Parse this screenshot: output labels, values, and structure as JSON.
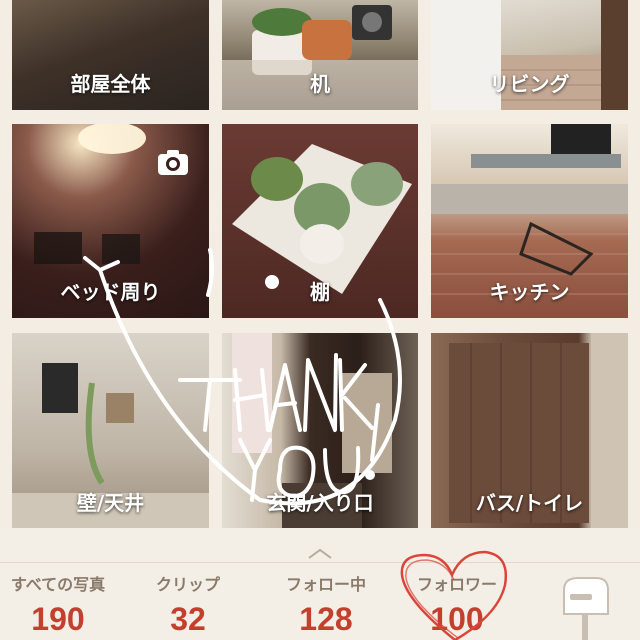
{
  "categories": [
    {
      "label": "部屋全体"
    },
    {
      "label": "机"
    },
    {
      "label": "リビング"
    },
    {
      "label": "ベッド周り"
    },
    {
      "label": "棚"
    },
    {
      "label": "キッチン"
    },
    {
      "label": "壁/天井"
    },
    {
      "label": "玄関/入り口"
    },
    {
      "label": "バス/トイレ"
    }
  ],
  "icons": {
    "camera": "camera-icon",
    "expand": "chevron-up-icon",
    "mailbox": "mailbox-icon"
  },
  "stats": [
    {
      "label": "すべての写真",
      "value": "190"
    },
    {
      "label": "クリップ",
      "value": "32"
    },
    {
      "label": "フォロー中",
      "value": "128"
    },
    {
      "label": "フォロワー",
      "value": "100"
    }
  ],
  "colors": {
    "accent": "#c4402e",
    "stat_label": "#8a7a6a",
    "background": "#f4efe6",
    "heart": "#d9453b"
  }
}
